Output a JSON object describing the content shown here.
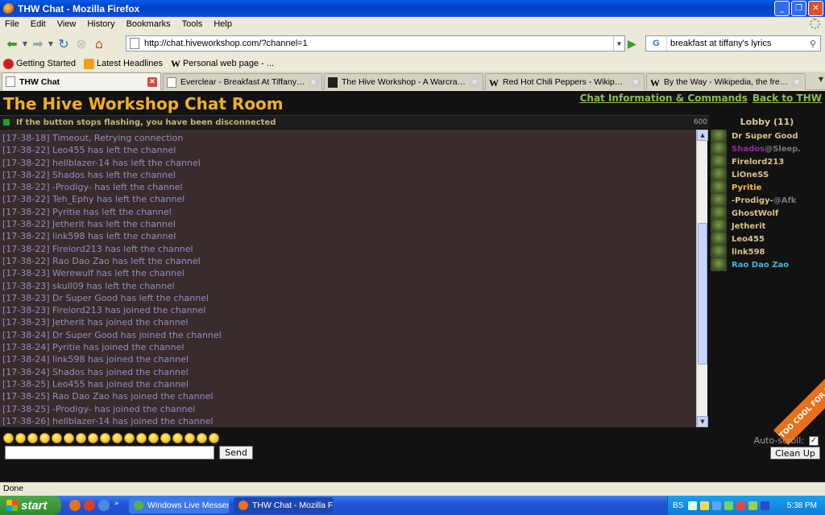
{
  "window": {
    "title": "THW Chat - Mozilla Firefox"
  },
  "menu": [
    "File",
    "Edit",
    "View",
    "History",
    "Bookmarks",
    "Tools",
    "Help"
  ],
  "nav": {
    "url": "http://chat.hiveworkshop.com/?channel=1",
    "search_engine": "G",
    "search_value": "breakfast at tiffany's lyrics"
  },
  "bookmarks": [
    "Getting Started",
    "Latest Headlines",
    "Personal web page - ..."
  ],
  "tabs": [
    {
      "label": "THW Chat",
      "active": true
    },
    {
      "label": "Everclear - Breakfast At Tiffany's Lyrics"
    },
    {
      "label": "The Hive Workshop - A Warcraft III M..."
    },
    {
      "label": "Red Hot Chili Peppers - Wikipedia, the ..."
    },
    {
      "label": "By the Way - Wikipedia, the free ency..."
    }
  ],
  "page": {
    "title": "The Hive Workshop Chat Room",
    "links": [
      "Chat Information & Commands",
      "Back to THW"
    ],
    "status_message": "If the button stops flashing, you have been disconnected",
    "status_count": "600",
    "lobby_title": "Lobby (11)",
    "messages": [
      "[17-38-18] Timeout, Retrying connection",
      "[17-38-22] Leo455 has left the channel",
      "[17-38-22] hellblazer-14 has left the channel",
      "[17-38-22] Shados has left the channel",
      "[17-38-22] -Prodigy- has left the channel",
      "[17-38-22] Teh_Ephy has left the channel",
      "[17-38-22] Pyritie has left the channel",
      "[17-38-22] Jetherit has left the channel",
      "[17-38-22] link598 has left the channel",
      "[17-38-22] Firelord213 has left the channel",
      "[17-38-22] Rao Dao Zao has left the channel",
      "[17-38-23] Werewulf has left the channel",
      "[17-38-23] skull09 has left the channel",
      "[17-38-23] Dr Super Good has left the channel",
      "[17-38-23] Firelord213 has joined the channel",
      "[17-38-23] Jetherit has joined the channel",
      "[17-38-24] Dr Super Good has joined the channel",
      "[17-38-24] Pyritie has joined the channel",
      "[17-38-24] link598 has joined the channel",
      "[17-38-24] Shados has joined the channel",
      "[17-38-25] Leo455 has joined the channel",
      "[17-38-25] Rao Dao Zao has joined the channel",
      "[17-38-25] -Prodigy- has joined the channel",
      "[17-38-26] hellblazer-14 has joined the channel"
    ],
    "users": [
      {
        "name": "Dr Super Good",
        "suffix": "",
        "color": "#d9c28a"
      },
      {
        "name": "Shados",
        "suffix": "@Sleep.",
        "color": "#9a2aa0"
      },
      {
        "name": "Firelord213",
        "suffix": "",
        "color": "#d9c28a"
      },
      {
        "name": "LiOneSS",
        "suffix": "",
        "color": "#d9c28a"
      },
      {
        "name": "Pyritie",
        "suffix": "",
        "color": "#f0c030"
      },
      {
        "name": "-Prodigy-",
        "suffix": "@Afk",
        "color": "#d9c28a"
      },
      {
        "name": "GhostWolf",
        "suffix": "",
        "color": "#d9c28a"
      },
      {
        "name": "Jetherit",
        "suffix": "",
        "color": "#d9c28a"
      },
      {
        "name": "Leo455",
        "suffix": "",
        "color": "#d9c28a"
      },
      {
        "name": "link598",
        "suffix": "",
        "color": "#d9c28a"
      },
      {
        "name": "Rao Dao Zao",
        "suffix": "",
        "color": "#3fb8d8"
      }
    ],
    "badge_text": "TOO COOL FOR IE",
    "send_label": "Send",
    "autoscroll_label": "Auto-scroll:",
    "autoscroll_checked": true,
    "cleanup_label": "Clean Up"
  },
  "statusbar": {
    "text": "Done"
  },
  "taskbar": {
    "start_label": "start",
    "buttons": [
      "Windows Live Messen...",
      "THW Chat - Mozilla Fi..."
    ],
    "tray_lang": "BS",
    "clock": "5:38 PM"
  }
}
